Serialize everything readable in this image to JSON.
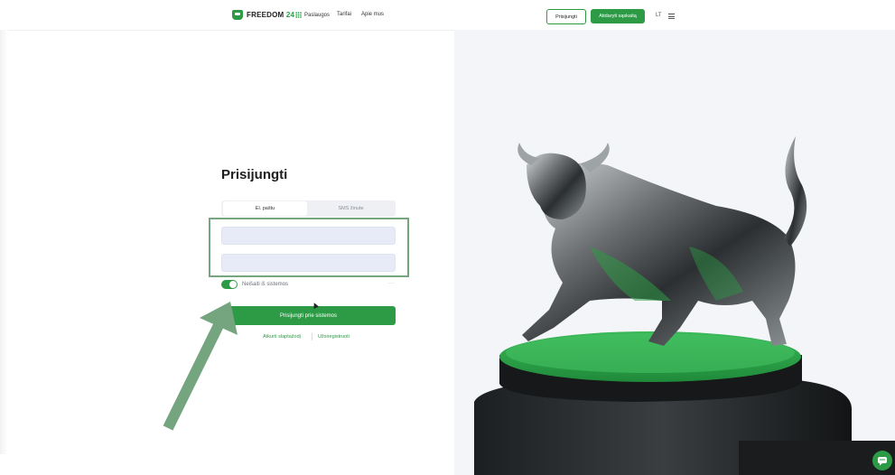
{
  "header": {
    "logo_text": "FREEDOM",
    "logo_number": "24",
    "nav": {
      "services": "Paslaugos",
      "tariffs": "Tarifai",
      "about": "Apie mus"
    },
    "login_button": "Prisijungti",
    "open_account_button": "Atidaryti sąskaitą",
    "language": "LT"
  },
  "login": {
    "title": "Prisijungti",
    "tabs": [
      {
        "label": "El. paštu"
      },
      {
        "label": "SMS žinute"
      }
    ],
    "email_value": "",
    "password_value": "",
    "remember_label": "Neišaiti iš sistemos",
    "remember_on": true,
    "more_label": "···",
    "submit_label": "Prisijungti prie sistemos",
    "forgot_link": "Atkurti slaptažodį",
    "register_link": "Užsiregistruoti"
  },
  "colors": {
    "brand_green": "#2d9b46",
    "highlight_box": "#76a67f",
    "annotation_arrow": "#75a57e",
    "input_bg": "#e6ebf7"
  },
  "icons": {
    "logo": "freedom-shield-icon",
    "services": "grid-icon",
    "menu": "hamburger-icon",
    "chat": "chat-bubble-icon",
    "annotation": "arrow-annotation-icon"
  }
}
